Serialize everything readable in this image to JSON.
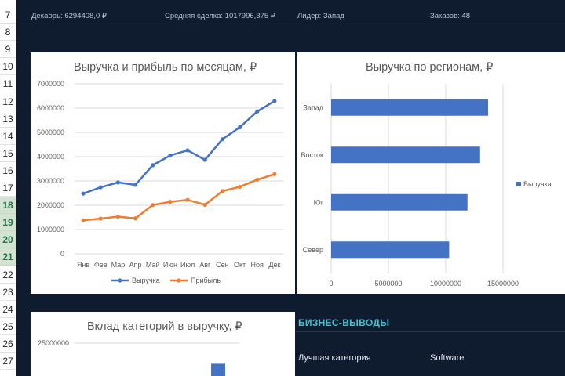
{
  "row_numbers": [
    "7",
    "8",
    "9",
    "10",
    "11",
    "12",
    "13",
    "14",
    "15",
    "16",
    "17",
    "18",
    "19",
    "20",
    "21",
    "22",
    "23",
    "24",
    "25",
    "26",
    "27"
  ],
  "selected_rows": [
    "18",
    "19",
    "20",
    "21"
  ],
  "kpis": {
    "december": "Декабрь: 6294408,0 ₽",
    "avg_deal": "Средняя сделка: 1017996,375 ₽",
    "leader": "Лидер: Запад",
    "orders": "Заказов: 48"
  },
  "chart_data": [
    {
      "type": "line",
      "title": "Выручка и прибыль по месяцам, ₽",
      "categories": [
        "Янв",
        "Фев",
        "Мар",
        "Апр",
        "Май",
        "Июн",
        "Июл",
        "Авг",
        "Сен",
        "Окт",
        "Ноя",
        "Дек"
      ],
      "series": [
        {
          "name": "Выручка",
          "color": "#4472c4",
          "values": [
            2480000,
            2740000,
            2940000,
            2840000,
            3650000,
            4050000,
            4260000,
            3870000,
            4720000,
            5210000,
            5860000,
            6294408
          ]
        },
        {
          "name": "Прибыль",
          "color": "#ed7d31",
          "values": [
            1380000,
            1450000,
            1530000,
            1460000,
            2010000,
            2140000,
            2220000,
            2020000,
            2580000,
            2760000,
            3050000,
            3280000
          ]
        }
      ],
      "ylim": [
        0,
        7000000
      ],
      "yticks": [
        "0",
        "1000000",
        "2000000",
        "3000000",
        "4000000",
        "5000000",
        "6000000",
        "7000000"
      ],
      "legend": "bottom",
      "grid": true
    },
    {
      "type": "bar",
      "orientation": "horizontal",
      "title": "Выручка по регионам, ₽",
      "categories": [
        "Запад",
        "Восток",
        "Юг",
        "Север"
      ],
      "series": [
        {
          "name": "Выручка",
          "color": "#4472c4",
          "values": [
            13700000,
            13000000,
            11900000,
            10300000
          ]
        }
      ],
      "xlim": [
        0,
        15000000
      ],
      "xticks": [
        "0",
        "5000000",
        "10000000",
        "15000000"
      ],
      "legend": "right",
      "grid": true
    },
    {
      "type": "bar",
      "title": "Вклад категорий в выручку, ₽",
      "yticks_visible": [
        "25000000"
      ],
      "ylim": [
        0,
        25000000
      ],
      "values": [
        22000000
      ],
      "color": "#4472c4"
    }
  ],
  "business": {
    "header": "БИЗНЕС-ВЫВОДЫ",
    "best_category_label": "Лучшая категория",
    "best_category_value": "Software"
  }
}
